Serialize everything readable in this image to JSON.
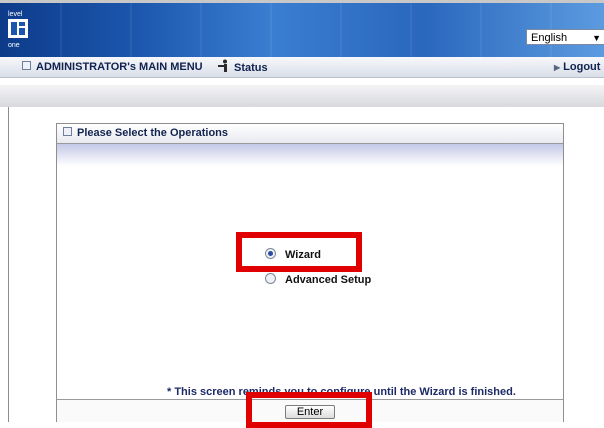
{
  "header": {
    "logo_text": [
      "level",
      "one"
    ],
    "language": {
      "selected": "English"
    }
  },
  "menubar": {
    "admin_menu": "ADMINISTRATOR's MAIN MENU",
    "status": "Status",
    "logout": "Logout"
  },
  "panel": {
    "title": "Please Select the Operations",
    "options": [
      {
        "label": "Wizard",
        "selected": true
      },
      {
        "label": "Advanced Setup",
        "selected": false
      }
    ],
    "note": "* This screen reminds you to configure until the Wizard is finished.",
    "enter_label": "Enter"
  },
  "colors": {
    "header_dark": "#0d3b8a",
    "header_light": "#5c9be0",
    "highlight": "#e10000",
    "note_text": "#1c2a66"
  }
}
